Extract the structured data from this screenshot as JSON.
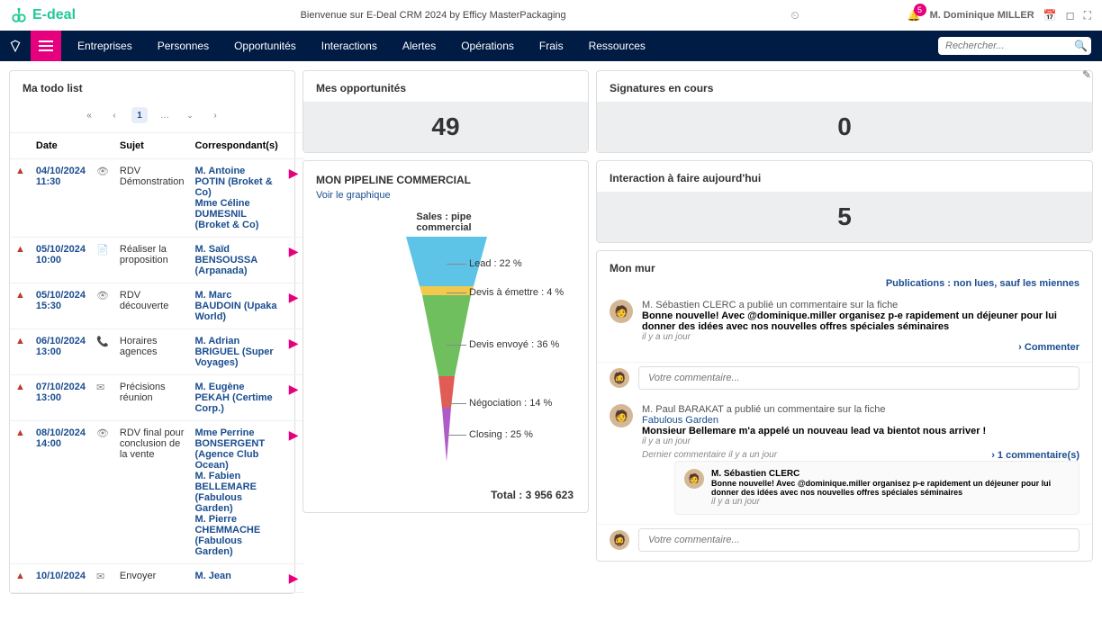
{
  "top": {
    "logo_text": "E-deal",
    "center_title": "Bienvenue sur E-Deal CRM 2024 by Efficy MasterPackaging",
    "bell_count": "5",
    "username": "M. Dominique MILLER"
  },
  "nav": {
    "items": [
      "Entreprises",
      "Personnes",
      "Opportunités",
      "Interactions",
      "Alertes",
      "Opérations",
      "Frais",
      "Ressources"
    ],
    "search_placeholder": "Rechercher..."
  },
  "todo": {
    "title": "Ma todo list",
    "page": "1",
    "headers": {
      "date": "Date",
      "sujet": "Sujet",
      "correspondants": "Correspondant(s)"
    },
    "rows": [
      {
        "date": "04/10/2024 11:30",
        "icon": "eye",
        "sujet": "RDV Démonstration",
        "corr": "M. Antoine POTIN (Broket & Co)\nMme Céline DUMESNIL (Broket & Co)"
      },
      {
        "date": "05/10/2024 10:00",
        "icon": "doc",
        "sujet": "Réaliser la proposition",
        "corr": "M. Saïd BENSOUSSA (Arpanada)"
      },
      {
        "date": "05/10/2024 15:30",
        "icon": "eye",
        "sujet": "RDV découverte",
        "corr": "M. Marc BAUDOIN (Upaka World)"
      },
      {
        "date": "06/10/2024 13:00",
        "icon": "phone",
        "sujet": "Horaires agences",
        "corr": "M. Adrian BRIGUEL (Super Voyages)"
      },
      {
        "date": "07/10/2024 13:00",
        "icon": "mail",
        "sujet": "Précisions réunion",
        "corr": "M. Eugène PEKAH (Certime Corp.)"
      },
      {
        "date": "08/10/2024 14:00",
        "icon": "eye",
        "sujet": "RDV final pour conclusion de la vente",
        "corr": "Mme Perrine BONSERGENT (Agence Club Ocean)\nM. Fabien BELLEMARE (Fabulous Garden)\nM. Pierre CHEMMACHE (Fabulous Garden)"
      },
      {
        "date": "10/10/2024",
        "icon": "mail",
        "sujet": "Envoyer",
        "corr": "M. Jean"
      }
    ]
  },
  "opps": {
    "title": "Mes opportunités",
    "count": "49"
  },
  "pipeline": {
    "title": "MON PIPELINE COMMERCIAL",
    "link": "Voir le graphique",
    "caption": "Sales : pipe commercial",
    "total_label": "Total : 3 956 623",
    "stages": [
      {
        "label": "Lead : 22 %",
        "color": "#5dc4e8"
      },
      {
        "label": "Devis à émettre : 4 %",
        "color": "#f2c94c"
      },
      {
        "label": "Devis envoyé : 36 %",
        "color": "#6fbf5e"
      },
      {
        "label": "Négociation : 14 %",
        "color": "#e05c55"
      },
      {
        "label": "Closing : 25 %",
        "color": "#b05cc7"
      }
    ]
  },
  "chart_data": {
    "type": "funnel",
    "title": "Sales : pipe commercial",
    "categories": [
      "Lead",
      "Devis à émettre",
      "Devis envoyé",
      "Négociation",
      "Closing"
    ],
    "values_pct": [
      22,
      4,
      36,
      14,
      25
    ],
    "total": 3956623,
    "total_label": "Total : 3 956 623",
    "colors": [
      "#5dc4e8",
      "#f2c94c",
      "#6fbf5e",
      "#e05c55",
      "#b05cc7"
    ]
  },
  "signatures": {
    "title": "Signatures en cours",
    "count": "0"
  },
  "interactions": {
    "title": "Interaction à faire aujourd'hui",
    "count": "5"
  },
  "wall": {
    "title": "Mon mur",
    "filter": "Publications : non lues, sauf les miennes",
    "comment_placeholder": "Votre commentaire...",
    "comment_action": "Commenter",
    "posts": [
      {
        "author_line": "M. Sébastien CLERC a publié un commentaire sur la fiche",
        "body": "Bonne nouvelle! Avec @dominique.miller organisez p-e rapidement un déjeuner pour lui donner des idées avec nos nouvelles offres spéciales séminaires",
        "time": "il y a un jour"
      },
      {
        "author_line": "M. Paul BARAKAT a publié un commentaire sur la fiche",
        "link": "Fabulous Garden",
        "body": "Monsieur Bellemare m'a appelé un nouveau lead va bientot nous arriver !",
        "time": "il y a un jour",
        "last_comment": "Dernier commentaire il y a un jour",
        "more": "1 commentaire(s)",
        "nested": {
          "author": "M. Sébastien CLERC",
          "body": "Bonne nouvelle! Avec @dominique.miller organisez p-e rapidement un déjeuner pour lui donner des idées avec nos nouvelles offres spéciales séminaires",
          "time": "il y a un jour"
        }
      }
    ]
  }
}
